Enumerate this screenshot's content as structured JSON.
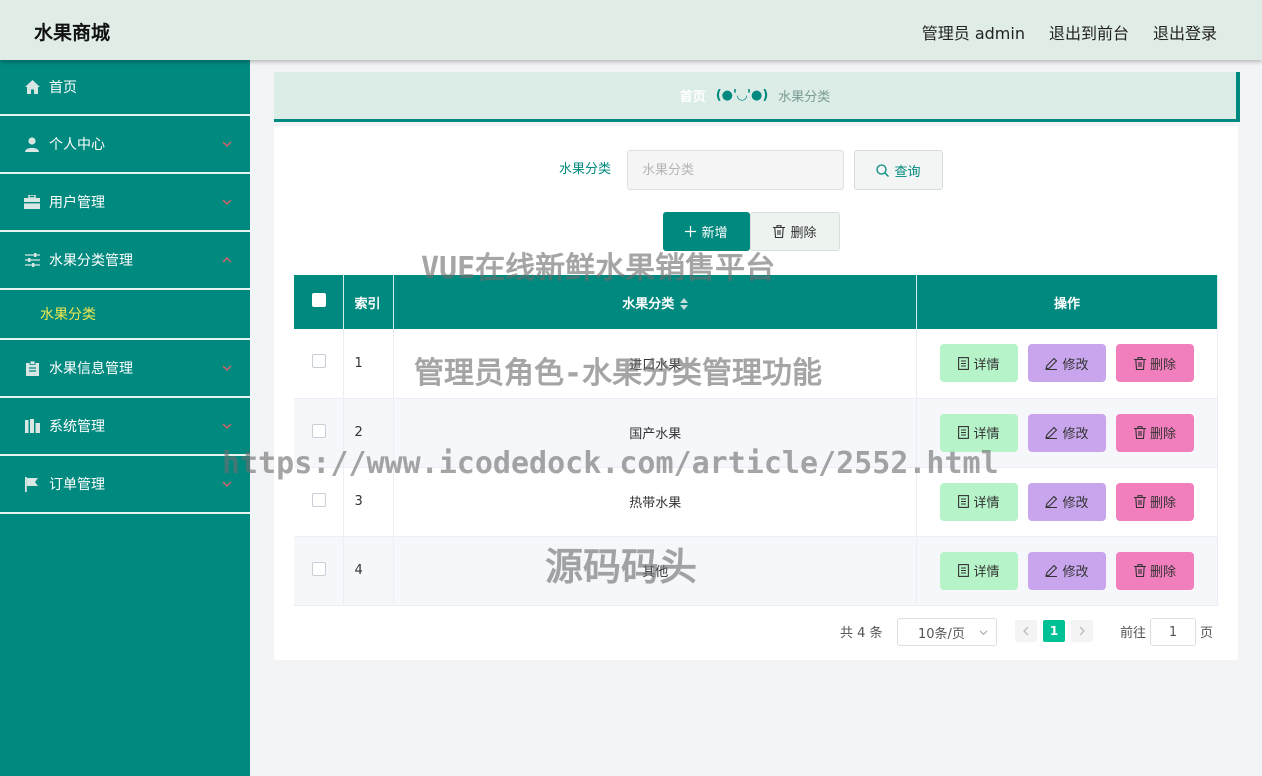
{
  "header": {
    "brand": "水果商城",
    "links": [
      "管理员 admin",
      "退出到前台",
      "退出登录"
    ]
  },
  "sidebar": {
    "items": [
      {
        "label": "首页",
        "icon": "home-icon"
      },
      {
        "label": "个人中心",
        "icon": "user-icon"
      },
      {
        "label": "用户管理",
        "icon": "briefcase-icon"
      },
      {
        "label": "水果分类管理",
        "icon": "sliders-icon",
        "expanded": true
      },
      {
        "label": "水果信息管理",
        "icon": "clipboard-icon"
      },
      {
        "label": "系统管理",
        "icon": "bars-icon"
      },
      {
        "label": "订单管理",
        "icon": "flag-icon"
      }
    ],
    "submenu": {
      "label": "水果分类"
    },
    "accent_color": "#00897f",
    "active_sub_color": "#f0e84e"
  },
  "breadcrumb": {
    "home": "首页",
    "face": "(●'◡'●)",
    "current": "水果分类"
  },
  "search": {
    "label": "水果分类",
    "placeholder": "水果分类",
    "query_button": "查询"
  },
  "toolbar": {
    "add_label": "新增",
    "delete_label": "删除"
  },
  "table": {
    "columns": [
      "索引",
      "水果分类",
      "操作"
    ],
    "rows": [
      {
        "index": "1",
        "name": "进口水果"
      },
      {
        "index": "2",
        "name": "国产水果"
      },
      {
        "index": "3",
        "name": "热带水果"
      },
      {
        "index": "4",
        "name": "其他"
      }
    ],
    "actions": {
      "detail": "详情",
      "edit": "修改",
      "delete": "删除"
    }
  },
  "pagination": {
    "total": "共 4 条",
    "page_size": "10条/页",
    "current_page": "1",
    "goto": "前往",
    "goto_value": "1",
    "page_unit": "页"
  },
  "watermarks": [
    "VUE在线新鲜水果销售平台",
    "管理员角色-水果分类管理功能",
    "https://www.icodedock.com/article/2552.html",
    "源码码头"
  ]
}
